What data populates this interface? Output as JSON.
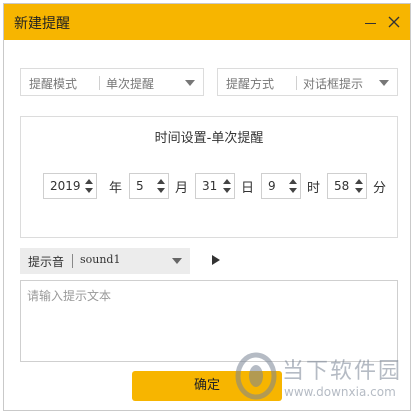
{
  "window": {
    "title": "新建提醒",
    "accent_color": "#f7b500"
  },
  "reminder_mode": {
    "label": "提醒模式",
    "value": "单次提醒"
  },
  "reminder_method": {
    "label": "提醒方式",
    "value": "对话框提示"
  },
  "time_settings": {
    "title": "时间设置-单次提醒",
    "year": {
      "value": "2019",
      "unit": "年"
    },
    "month": {
      "value": "5",
      "unit": "月"
    },
    "day": {
      "value": "31",
      "unit": "日"
    },
    "hour": {
      "value": "9",
      "unit": "时"
    },
    "minute": {
      "value": "58",
      "unit": "分"
    }
  },
  "sound": {
    "label": "提示音",
    "value": "sound1"
  },
  "text_input": {
    "placeholder": "请输入提示文本"
  },
  "confirm_label": "确定",
  "watermark": {
    "brand": "当下软件园",
    "url": "www.downxia.com"
  }
}
